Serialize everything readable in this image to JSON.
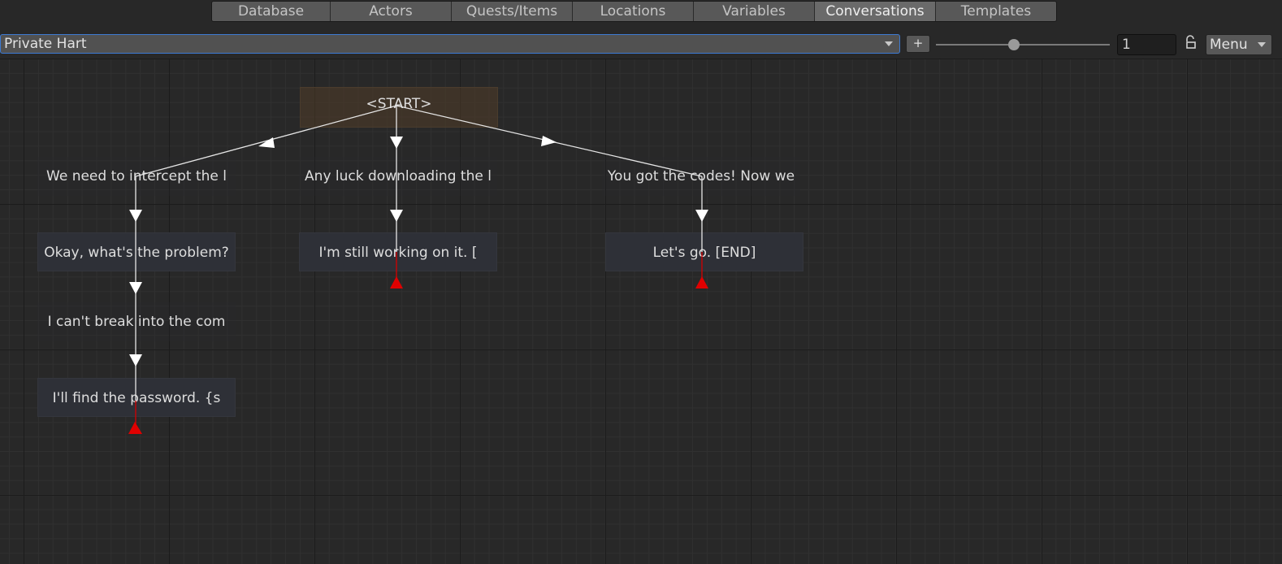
{
  "tabs": [
    {
      "label": "Database",
      "active": false
    },
    {
      "label": "Actors",
      "active": false
    },
    {
      "label": "Quests/Items",
      "active": false
    },
    {
      "label": "Locations",
      "active": false
    },
    {
      "label": "Variables",
      "active": false
    },
    {
      "label": "Conversations",
      "active": true
    },
    {
      "label": "Templates",
      "active": false
    }
  ],
  "toolbar": {
    "conversation": "Private Hart",
    "add_label": "+",
    "zoom_value": "1",
    "zoom_slider_fraction": 0.45,
    "menu_label": "Menu"
  },
  "nodes": {
    "start": "<START>",
    "n1": "We need to intercept the l",
    "n2": "Any luck downloading the l",
    "n3": "You got the codes! Now we",
    "n4": "Okay, what's the problem?",
    "n5": "I'm still working on it. [",
    "n6": "Let's go. [END]",
    "n7": "I can't break into the com",
    "n8": "I'll find the password. {s"
  },
  "colors": {
    "active_tab": "#6a6a6a",
    "focus_border": "#3d7ad3",
    "link": "#e6e6e6",
    "end_marker": "#e00000",
    "start_node": "#503c28"
  }
}
